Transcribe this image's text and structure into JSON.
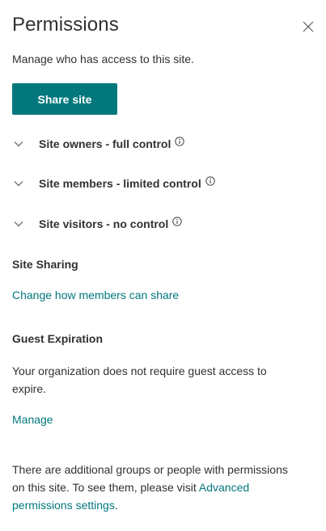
{
  "panel": {
    "title": "Permissions",
    "subtitle": "Manage who has access to this site.",
    "close_icon": "close-icon",
    "share_button_label": "Share site"
  },
  "groups": [
    {
      "label": "Site owners - full control",
      "icon": "chevron-down-icon"
    },
    {
      "label": "Site members - limited control",
      "icon": "chevron-down-icon"
    },
    {
      "label": "Site visitors - no control",
      "icon": "chevron-down-icon"
    }
  ],
  "site_sharing": {
    "heading": "Site Sharing",
    "link_label": "Change how members can share"
  },
  "guest_expiration": {
    "heading": "Guest Expiration",
    "description": "Your organization does not require guest access to expire.",
    "manage_label": "Manage"
  },
  "footer": {
    "text_prefix": "There are additional groups or people with permissions on this site. To see them, please visit ",
    "link_label": "Advanced permissions settings",
    "text_suffix": "."
  },
  "colors": {
    "accent": "#03787c",
    "text": "#323130"
  }
}
